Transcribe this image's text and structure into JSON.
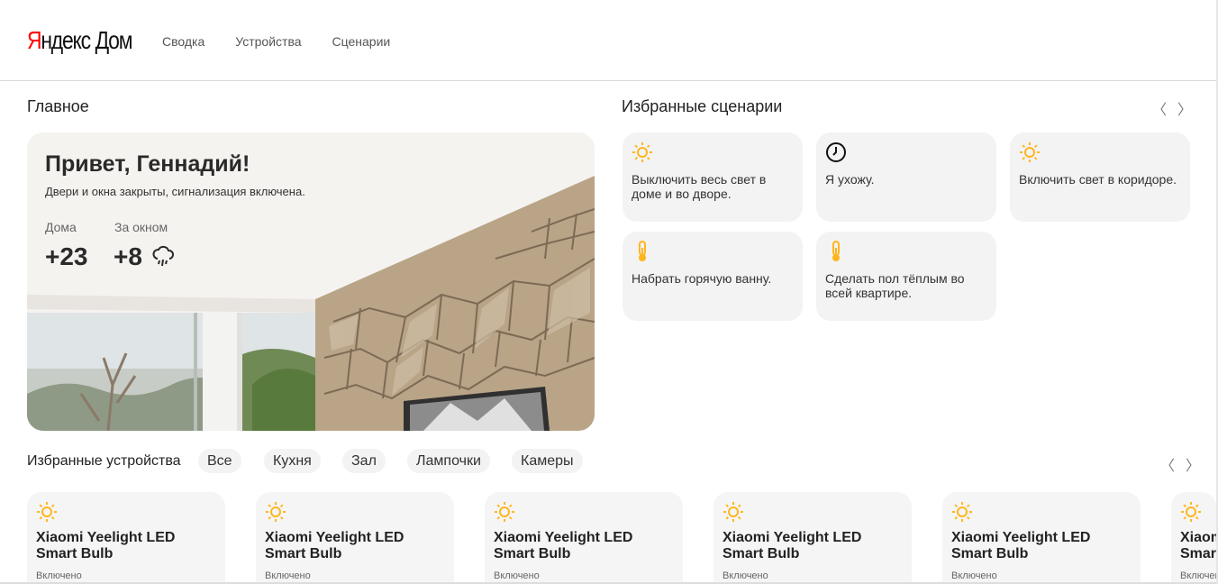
{
  "header": {
    "logo_y": "Я",
    "logo_rest": "ндекс",
    "logo_dom": "Дом",
    "nav": [
      "Сводка",
      "Устройства",
      "Сценарии"
    ]
  },
  "main": {
    "title": "Главное",
    "greeting": "Привет, Геннадий!",
    "status": "Двери и окна закрыты, сигнализация включена.",
    "home_label": "Дома",
    "home_temp": "+23",
    "outside_label": "За окном",
    "outside_temp": "+8",
    "weather_icon": "rain-cloud-icon"
  },
  "scenarios": {
    "title": "Избранные сценарии",
    "prev": "〈",
    "next": "〉",
    "items": [
      {
        "icon": "sun-icon",
        "label": "Выключить весь свет в доме и во дворе."
      },
      {
        "icon": "clock-icon",
        "label": "Я ухожу."
      },
      {
        "icon": "sun-icon",
        "label": "Включить свет в коридоре."
      },
      {
        "icon": "thermometer-icon",
        "label": "Набрать горячую ванну."
      },
      {
        "icon": "thermometer-icon",
        "label": "Сделать пол тёплым во всей квартире."
      }
    ]
  },
  "devices": {
    "title": "Избранные устройства",
    "filters": [
      "Все",
      "Кухня",
      "Зал",
      "Лампочки",
      "Камеры"
    ],
    "prev": "〈",
    "next": "〉",
    "items": [
      {
        "icon": "sun-icon",
        "name": "Xiaomi Yeelight LED Smart Bulb",
        "status": "Включено"
      },
      {
        "icon": "sun-icon",
        "name": "Xiaomi Yeelight LED Smart Bulb",
        "status": "Включено"
      },
      {
        "icon": "sun-icon",
        "name": "Xiaomi Yeelight LED Smart Bulb",
        "status": "Включено"
      },
      {
        "icon": "sun-icon",
        "name": "Xiaomi Yeelight LED Smart Bulb",
        "status": "Включено"
      },
      {
        "icon": "sun-icon",
        "name": "Xiaomi Yeelight LED Smart Bulb",
        "status": "Включено"
      },
      {
        "icon": "sun-icon",
        "name": "Xiaomi Yeelight LED Smart Bulb",
        "status": "Включено"
      }
    ]
  },
  "colors": {
    "accent": "#ffb61e",
    "brand_red": "#ff0000",
    "card_bg": "#f3f3f3"
  }
}
